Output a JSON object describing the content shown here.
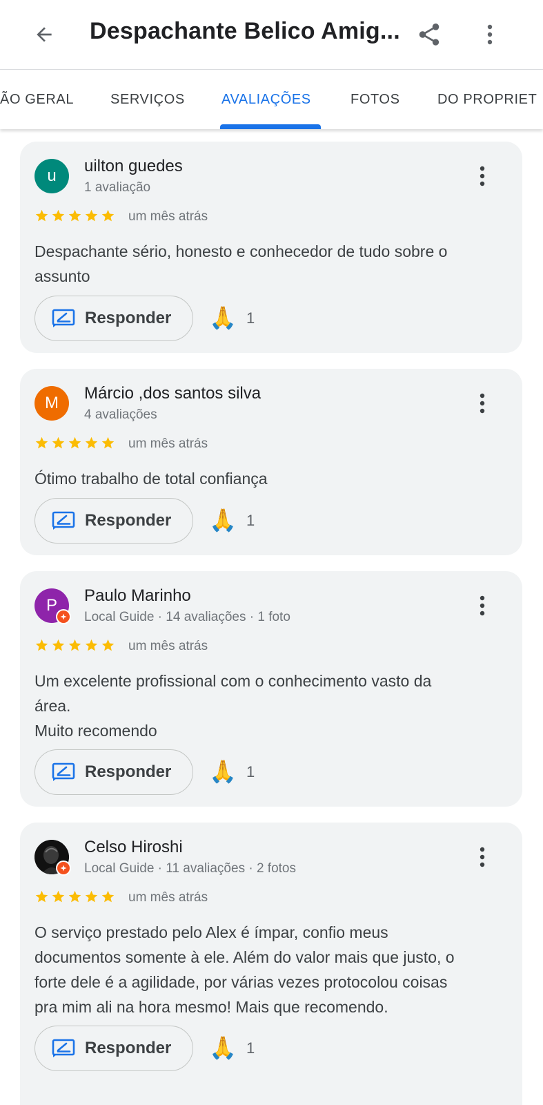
{
  "header": {
    "title": "Despachante Belico Amig...",
    "icons": {
      "back": "back-arrow-icon",
      "share": "share-icon",
      "more": "more-vert-icon"
    }
  },
  "tabs": [
    {
      "label": "ÃO GERAL",
      "active": false
    },
    {
      "label": "SERVIÇOS",
      "active": false
    },
    {
      "label": "AVALIAÇÕES",
      "active": true
    },
    {
      "label": "FOTOS",
      "active": false
    },
    {
      "label": "DO PROPRIET",
      "active": false
    }
  ],
  "colors": {
    "accent": "#1a73e8",
    "star": "#fbbc04",
    "card_bg": "#f1f3f4",
    "guide_badge": "#f4511e"
  },
  "reviews": [
    {
      "author": "uilton guedes",
      "avatar_letter": "u",
      "avatar_color": "#00897b",
      "meta": "1 avaliação",
      "rating": 5,
      "time": "um mês atrás",
      "text": "Despachante sério, honesto e conhecedor de tudo sobre o\nassunto",
      "reply_label": "Responder",
      "reaction_emoji": "🙏",
      "reaction_count": "1"
    },
    {
      "author": "Márcio ,dos santos silva",
      "avatar_letter": "M",
      "avatar_color": "#ef6c00",
      "meta": "4 avaliações",
      "rating": 5,
      "time": "um mês atrás",
      "text": "Ótimo trabalho de total confiança",
      "reply_label": "Responder",
      "reaction_emoji": "🙏",
      "reaction_count": "1"
    },
    {
      "author": "Paulo Marinho",
      "avatar_letter": "P",
      "avatar_color": "#8e24aa",
      "meta": "Local Guide · 14 avaliações · 1 foto",
      "rating": 5,
      "time": "um mês atrás",
      "text": "Um excelente profissional com o conhecimento vasto da\nárea.\nMuito recomendo",
      "reply_label": "Responder",
      "reaction_emoji": "🙏",
      "reaction_count": "1"
    },
    {
      "author": "Celso Hiroshi",
      "avatar_letter": "",
      "avatar_color": "#1f1f1f",
      "meta": "Local Guide · 11 avaliações · 2 fotos",
      "rating": 5,
      "time": "um mês atrás",
      "text": "O serviço prestado pelo Alex é ímpar, confio meus\ndocumentos somente à ele. Além do valor mais que justo, o\nforte dele é a agilidade, por várias vezes protocolou coisas\npra mim ali na hora mesmo! Mais que recomendo.",
      "reply_label": "Responder",
      "reaction_emoji": "🙏",
      "reaction_count": "1"
    }
  ]
}
